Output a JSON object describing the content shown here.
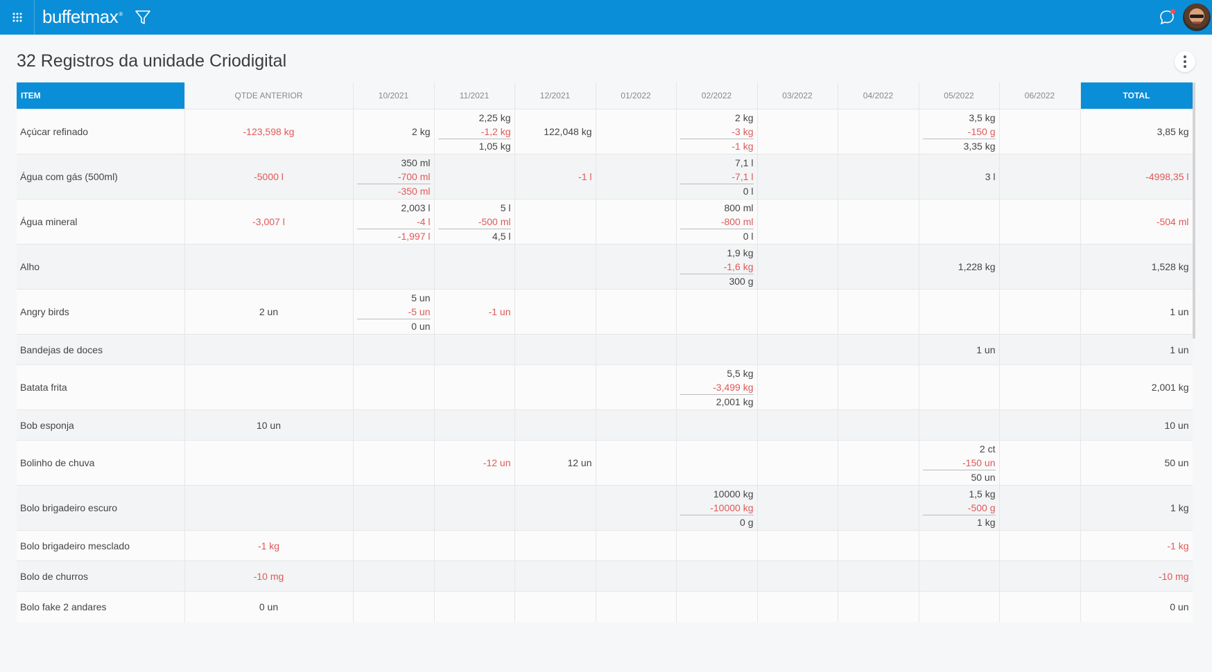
{
  "app": {
    "logo": "buffetmax"
  },
  "page": {
    "title": "32 Registros da unidade Criodigital"
  },
  "table": {
    "headers": {
      "item": "ITEM",
      "prev": "QTDE ANTERIOR",
      "months": [
        "10/2021",
        "11/2021",
        "12/2021",
        "01/2022",
        "02/2022",
        "03/2022",
        "04/2022",
        "05/2022",
        "06/2022"
      ],
      "total": "TOTAL"
    },
    "rows": [
      {
        "item": "Açúcar refinado",
        "prev": {
          "v": "-123,598 kg",
          "neg": true
        },
        "m": [
          [
            "2 kg"
          ],
          [
            "2,25 kg",
            "-1,2 kg",
            "1,05 kg"
          ],
          [
            "122,048 kg"
          ],
          [],
          [
            "2 kg",
            "-3 kg",
            "-1 kg"
          ],
          [],
          [],
          [
            "3,5 kg",
            "-150 g",
            "3,35 kg"
          ],
          []
        ],
        "total": {
          "v": "3,85 kg",
          "neg": false
        }
      },
      {
        "item": "Água com gás (500ml)",
        "prev": {
          "v": "-5000 l",
          "neg": true
        },
        "m": [
          [
            "350 ml",
            "-700 ml",
            "-350 ml"
          ],
          [],
          [
            "-1 l"
          ],
          [],
          [
            "7,1 l",
            "-7,1 l",
            "0 l"
          ],
          [],
          [],
          [
            "3 l"
          ],
          []
        ],
        "total": {
          "v": "-4998,35 l",
          "neg": true
        }
      },
      {
        "item": "Água mineral",
        "prev": {
          "v": "-3,007 l",
          "neg": true
        },
        "m": [
          [
            "2,003 l",
            "-4 l",
            "-1,997 l"
          ],
          [
            "5 l",
            "-500 ml",
            "4,5 l"
          ],
          [],
          [],
          [
            "800 ml",
            "-800 ml",
            "0 l"
          ],
          [],
          [],
          [],
          []
        ],
        "total": {
          "v": "-504 ml",
          "neg": true
        }
      },
      {
        "item": "Alho",
        "prev": {
          "v": "",
          "neg": false
        },
        "m": [
          [],
          [],
          [],
          [],
          [
            "1,9 kg",
            "-1,6 kg",
            "300 g"
          ],
          [],
          [],
          [
            "1,228 kg"
          ],
          []
        ],
        "total": {
          "v": "1,528 kg",
          "neg": false
        }
      },
      {
        "item": "Angry birds",
        "prev": {
          "v": "2 un",
          "neg": false
        },
        "m": [
          [
            "5 un",
            "-5 un",
            "0 un"
          ],
          [
            "-1 un"
          ],
          [],
          [],
          [],
          [],
          [],
          [],
          []
        ],
        "total": {
          "v": "1 un",
          "neg": false
        }
      },
      {
        "item": "Bandejas de doces",
        "prev": {
          "v": "",
          "neg": false
        },
        "m": [
          [],
          [],
          [],
          [],
          [],
          [],
          [],
          [
            "1 un"
          ],
          []
        ],
        "total": {
          "v": "1 un",
          "neg": false
        }
      },
      {
        "item": "Batata frita",
        "prev": {
          "v": "",
          "neg": false
        },
        "m": [
          [],
          [],
          [],
          [],
          [
            "5,5 kg",
            "-3,499 kg",
            "2,001 kg"
          ],
          [],
          [],
          [],
          []
        ],
        "total": {
          "v": "2,001 kg",
          "neg": false
        }
      },
      {
        "item": "Bob esponja",
        "prev": {
          "v": "10 un",
          "neg": false
        },
        "m": [
          [],
          [],
          [],
          [],
          [],
          [],
          [],
          [],
          []
        ],
        "total": {
          "v": "10 un",
          "neg": false
        }
      },
      {
        "item": "Bolinho de chuva",
        "prev": {
          "v": "",
          "neg": false
        },
        "m": [
          [],
          [
            "-12 un"
          ],
          [
            "12 un"
          ],
          [],
          [],
          [],
          [],
          [
            "2 ct",
            "-150 un",
            "50 un"
          ],
          []
        ],
        "total": {
          "v": "50 un",
          "neg": false
        }
      },
      {
        "item": "Bolo brigadeiro escuro",
        "prev": {
          "v": "",
          "neg": false
        },
        "m": [
          [],
          [],
          [],
          [],
          [
            "10000 kg",
            "-10000 kg",
            "0 g"
          ],
          [],
          [],
          [
            "1,5 kg",
            "-500 g",
            "1 kg"
          ],
          []
        ],
        "total": {
          "v": "1 kg",
          "neg": false
        }
      },
      {
        "item": "Bolo brigadeiro mesclado",
        "prev": {
          "v": "-1 kg",
          "neg": true
        },
        "m": [
          [],
          [],
          [],
          [],
          [],
          [],
          [],
          [],
          []
        ],
        "total": {
          "v": "-1 kg",
          "neg": true
        }
      },
      {
        "item": "Bolo de churros",
        "prev": {
          "v": "-10 mg",
          "neg": true
        },
        "m": [
          [],
          [],
          [],
          [],
          [],
          [],
          [],
          [],
          []
        ],
        "total": {
          "v": "-10 mg",
          "neg": true
        }
      },
      {
        "item": "Bolo fake 2 andares",
        "prev": {
          "v": "0 un",
          "neg": false
        },
        "m": [
          [],
          [],
          [],
          [],
          [],
          [],
          [],
          [],
          []
        ],
        "total": {
          "v": "0 un",
          "neg": false
        }
      }
    ]
  },
  "colors": {
    "accent": "#0a8ed8",
    "negative": "#e05858"
  },
  "icons": {
    "apps": "apps-grid-icon",
    "filter": "filter-icon",
    "chat": "chat-icon",
    "more": "more-vertical-icon"
  }
}
